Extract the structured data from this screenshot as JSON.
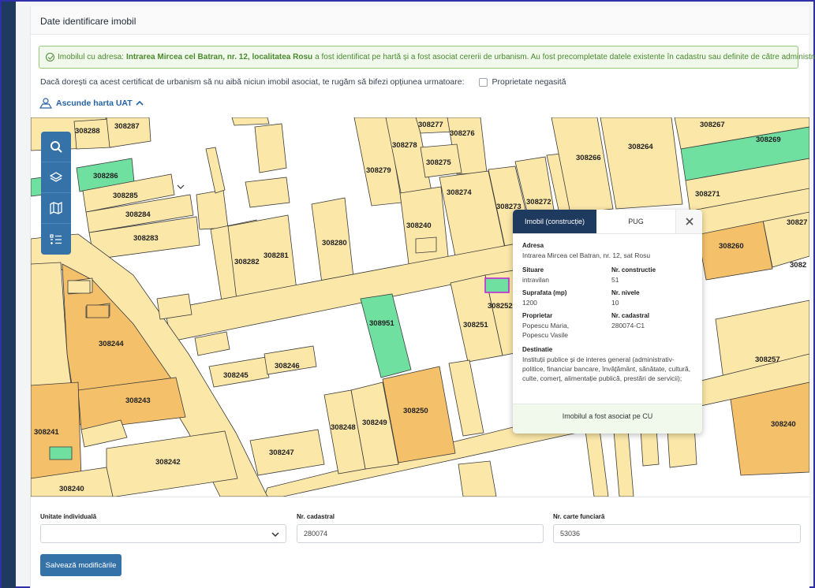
{
  "card": {
    "title": "Date identificare imobil"
  },
  "alert": {
    "prefix": "Imobilul cu adresa:",
    "address": "Intrarea Mircea cel Batran, nr. 12, localitatea Rosu",
    "suffix": "a fost identificat pe hartă și a fost asociat cererii de urbanism. Au fost precompletate datele existente în cadastru sau definite de către administrator."
  },
  "question": {
    "text": "Dacă dorești ca acest certificat de urbanism să nu aibă niciun imobil asociat, te rugăm să bifezi opțiunea urmatoare:",
    "checkbox_label": "Proprietate negasită"
  },
  "map_toggle": {
    "label": "Ascunde harta UAT"
  },
  "map": {
    "parcels": [
      "308288",
      "308287",
      "308286",
      "308285",
      "308284",
      "308283",
      "308282",
      "308281",
      "308280",
      "308279",
      "308278",
      "308277",
      "308276",
      "308275",
      "308274",
      "308273",
      "308272",
      "308240",
      "308266",
      "308264",
      "308267",
      "308269",
      "308271",
      "308260",
      "308244",
      "308243",
      "308245",
      "308246",
      "308951",
      "308251",
      "308252",
      "308250",
      "308249",
      "308248",
      "308247",
      "308242",
      "308241",
      "308257"
    ]
  },
  "toolbar": [
    {
      "icon": "search-icon"
    },
    {
      "icon": "layers-icon"
    },
    {
      "icon": "map-icon"
    },
    {
      "icon": "list-icon"
    }
  ],
  "popup": {
    "tabs": [
      "Imobil (construcție)",
      "PUG"
    ],
    "adresa_label": "Adresa",
    "adresa": "Intrarea Mircea cel Batran, nr. 12, sat Rosu",
    "situare_label": "Situare",
    "situare": "intravilan",
    "nr_constructie_label": "Nr. constructie",
    "nr_constructie": "51",
    "suprafata_label": "Suprafata (mp)",
    "suprafata": "1200",
    "nr_nivele_label": "Nr. nivele",
    "nr_nivele": "10",
    "proprietar_label": "Proprietar",
    "proprietar_1": "Popescu Maria,",
    "proprietar_2": "Popescu Vasile",
    "nr_cadastral_label": "Nr. cadastral",
    "nr_cadastral": "280074-C1",
    "destinatie_label": "Destinatie",
    "destinatie": "Instituții publice și de interes general (administrativ-politice, financiar bancare, învățământ, sănătate, cultură, culte, comerț, alimentație publică,  prestări de servicii);",
    "footer": "Imobilul a fost asociat pe CU"
  },
  "form": {
    "unitate_label": "Unitate individuală",
    "unitate_value": "",
    "nr_cadastral_label": "Nr. cadastral",
    "nr_cadastral_value": "280074",
    "nr_cf_label": "Nr. carte funciară",
    "nr_cf_value": "53036",
    "save_label": "Salvează modificările"
  },
  "colors": {
    "parcel": "#fbe7a8",
    "selected": "#6fe0a0",
    "highlight": "#f4c06a",
    "accent": "#3572a8",
    "nav": "#1f3a5f"
  }
}
